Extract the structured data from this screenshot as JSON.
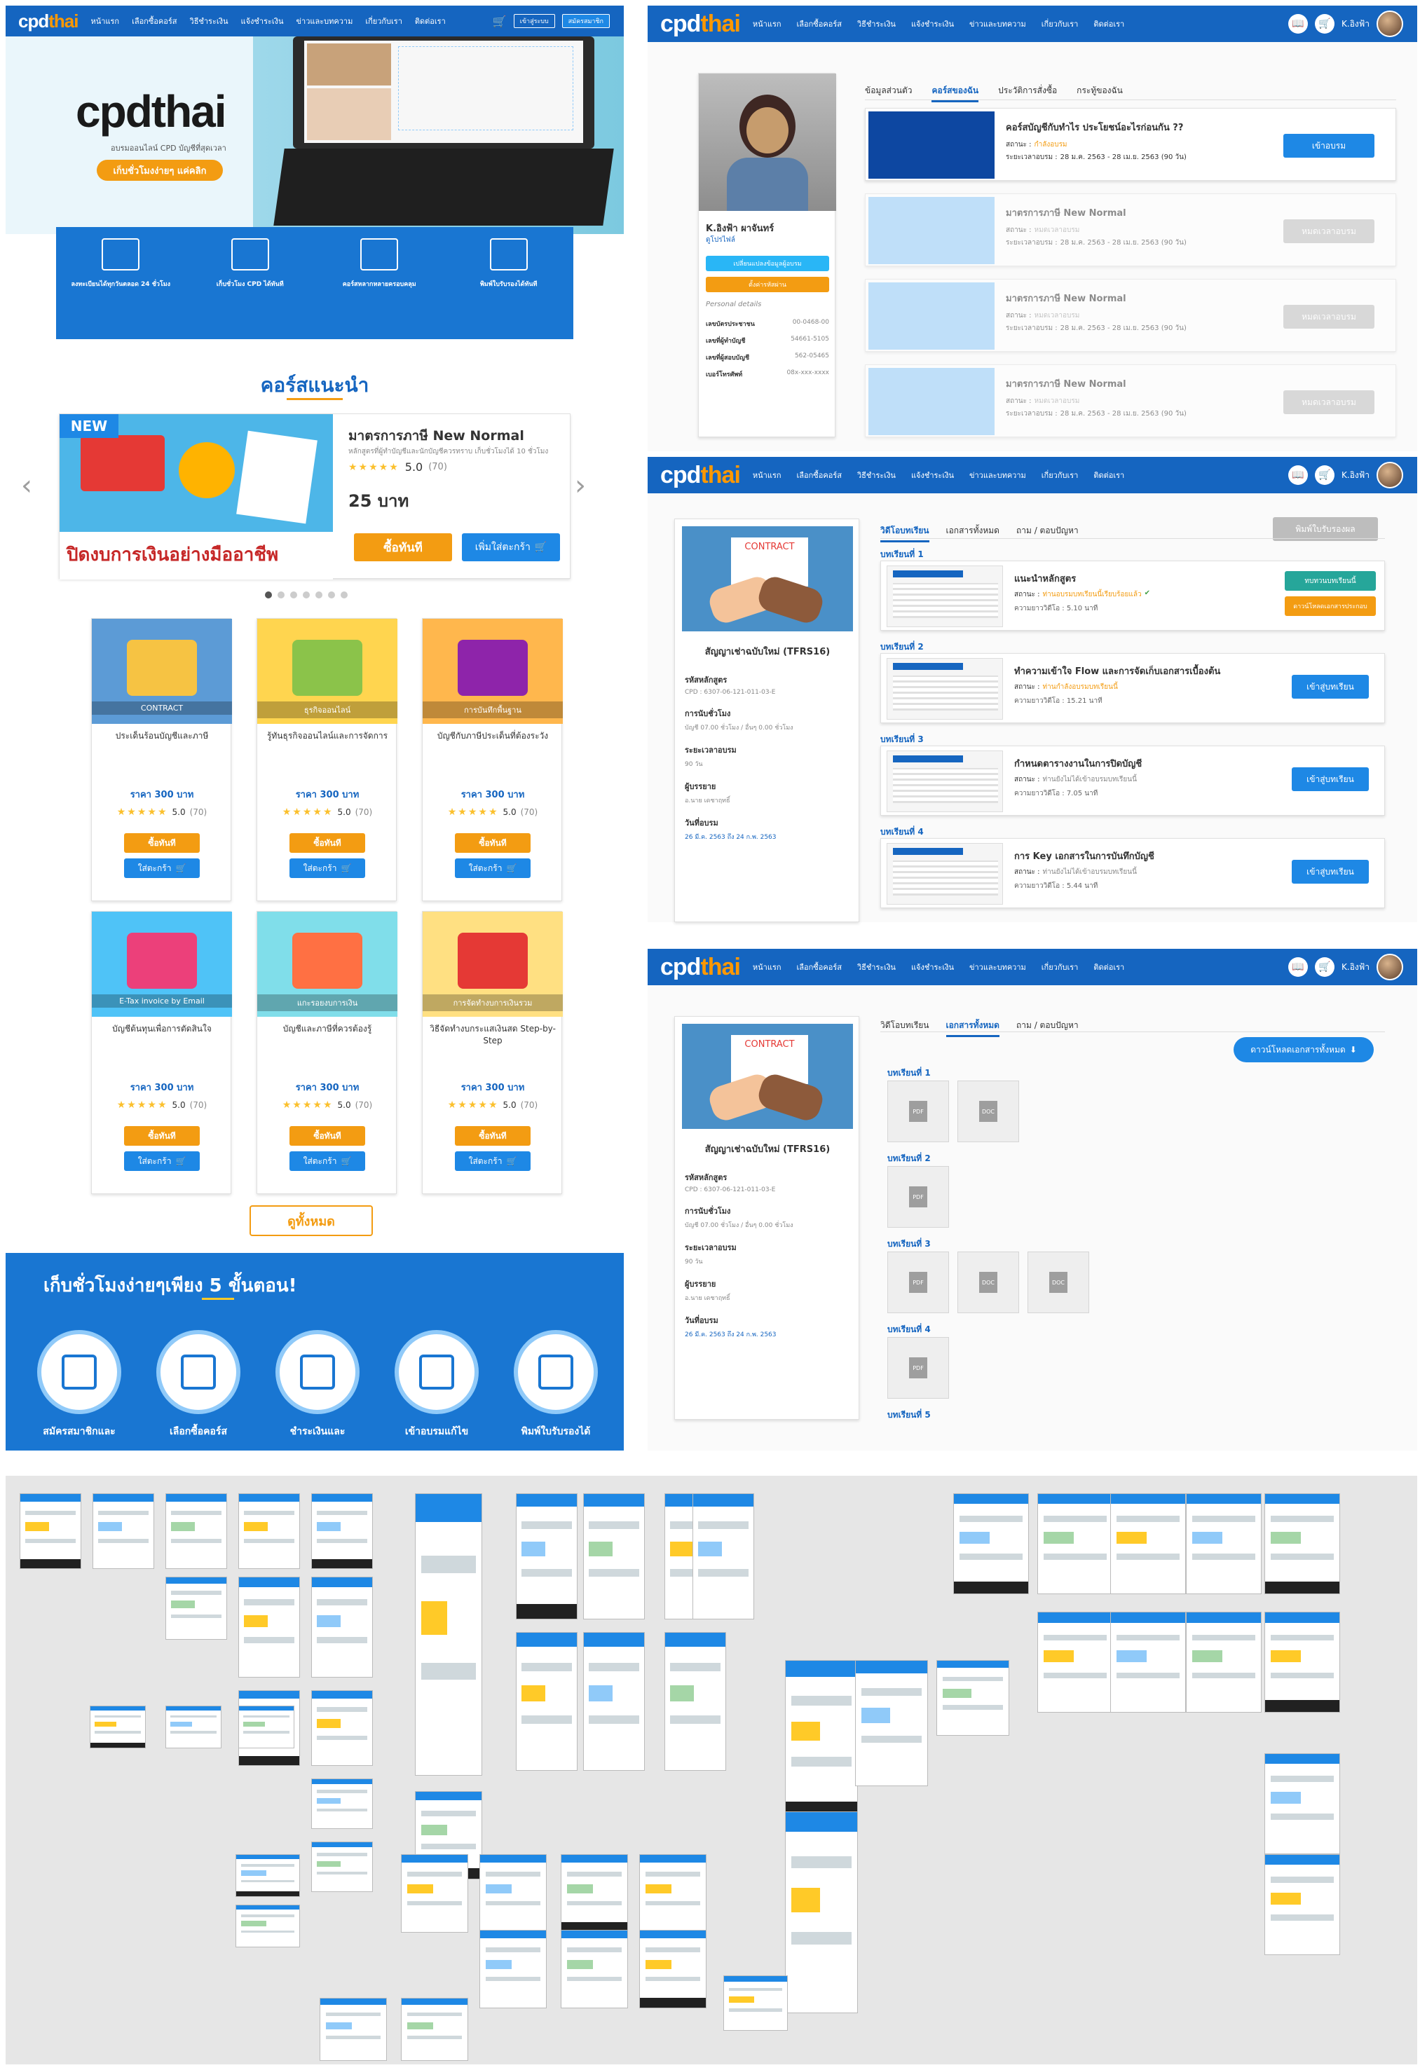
{
  "nav": {
    "logo_main": "cpd",
    "logo_accent": "thai",
    "menu": [
      "หน้าแรก",
      "เลือกซื้อคอร์ส",
      "วิธีชำระเงิน",
      "แจ้งชำระเงิน",
      "ข่าวและบทความ",
      "เกี่ยวกับเรา",
      "ติดต่อเรา"
    ],
    "user_name": "K.อิงฟ้า",
    "cart_count": "0",
    "login_label": "เข้าสู่ระบบ",
    "register_label": "สมัครสมาชิก"
  },
  "home": {
    "hero_logo": "cpdthai",
    "hero_tagline": "อบรมออนไลน์ CPD บัญชีที่สุดเวลา",
    "hero_button": "เก็บชั่วโมงง่ายๆ แค่คลิก",
    "features": [
      "ลงทะเบียนได้ทุกวันตลอด 24 ชั่วโมง",
      "เก็บชั่วโมง CPD ได้ทันที",
      "คอร์สหลากหลายครอบคลุม",
      "พิมพ์ใบรับรองได้ทันที"
    ],
    "recommend_title": "คอร์สแนะนำ",
    "featured": {
      "badge": "NEW",
      "title": "มาตรการภาษี New Normal",
      "desc": "หลักสูตรที่ผู้ทำบัญชีและนักบัญชีควรทราบ เก็บชั่วโมงได้ 10 ชั่วโมง",
      "rating": "5.0",
      "reviews": "(70)",
      "price": "25 บาท",
      "banner_text": "ปิดงบการเงินอย่างมืออาชีพ",
      "buy_label": "ซื้อทันที",
      "cart_label": "เพิ่มใส่ตะกร้า"
    },
    "courses": [
      {
        "title": "ประเด็นร้อนบัญชีและภาษี",
        "price": "ราคา 300 บาท",
        "rating": "5.0",
        "reviews": "(70)",
        "art": "#5c9bd6",
        "accent": "#f6c343",
        "tag": "CONTRACT"
      },
      {
        "title": "รู้ทันธุรกิจออนไลน์และการจัดการ",
        "price": "ราคา 300 บาท",
        "rating": "5.0",
        "reviews": "(70)",
        "art": "#ffd54f",
        "accent": "#8bc34a",
        "tag": "ธุรกิจออนไลน์"
      },
      {
        "title": "บัญชีกับภาษีประเด็นที่ต้องระวัง",
        "price": "ราคา 300 บาท",
        "rating": "5.0",
        "reviews": "(70)",
        "art": "#ffb74d",
        "accent": "#8e24aa",
        "tag": "การบันทึกพื้นฐาน"
      },
      {
        "title": "บัญชีต้นทุนเพื่อการตัดสินใจ",
        "price": "ราคา 300 บาท",
        "rating": "5.0",
        "reviews": "(70)",
        "art": "#4fc3f7",
        "accent": "#ec407a",
        "tag": "E-Tax invoice by Email"
      },
      {
        "title": "บัญชีและภาษีที่ควรต้องรู้",
        "price": "ราคา 300 บาท",
        "rating": "5.0",
        "reviews": "(70)",
        "art": "#80deea",
        "accent": "#ff7043",
        "tag": "แกะรอยงบการเงิน"
      },
      {
        "title": "วิธีจัดทำงบกระแสเงินสด Step-by-Step",
        "price": "ราคา 300 บาท",
        "rating": "5.0",
        "reviews": "(70)",
        "art": "#ffe082",
        "accent": "#e53935",
        "tag": "การจัดทำงบการเงินรวม"
      }
    ],
    "buy_label": "ซื้อทันที",
    "cart_label": "ใส่ตะกร้า",
    "view_all": "ดูทั้งหมด",
    "steps_title": "เก็บชั่วโมงง่ายๆเพียง 5 ขั้นตอน!",
    "steps": [
      "สมัครสมาชิกและ",
      "เลือกซื้อคอร์ส",
      "ชำระเงินและ",
      "เข้าอบรมแก้ไข",
      "พิมพ์ใบรับรองได้"
    ]
  },
  "profile": {
    "tabs": [
      "ข้อมูลส่วนตัว",
      "คอร์สของฉัน",
      "ประวัติการสั่งซื้อ",
      "กระทู้ของฉัน"
    ],
    "name": "K.อิงฟ้า ผาจันทร์",
    "edit_link": "ดูโปรไฟล์",
    "btn_profile": "เปลี่ยนแปลงข้อมูลผู้อบรม",
    "btn_password": "ตั้งค่ารหัสผ่าน",
    "info_title": "Personal details",
    "info": [
      [
        "เลขบัตรประชาชน",
        "00-0468-00"
      ],
      [
        "เลขที่ผู้ทำบัญชี",
        "54661-5105"
      ],
      [
        "เลขที่ผู้สอบบัญชี",
        "562-05465"
      ],
      [
        "เบอร์โทรศัพท์",
        "08x-xxx-xxxx"
      ]
    ],
    "courses": [
      {
        "title": "คอร์สบัญชีกับทำไร ประโยชน์อะไรก่อนกัน ??",
        "status": "กำลังอบรม",
        "period": "28 ม.ค. 2563 - 28 เม.ย. 2563 (90 วัน)",
        "button": "เข้าอบรม",
        "active": true
      },
      {
        "title": "มาตรการภาษี New Normal",
        "status": "หมดเวลาอบรม",
        "period": "28 ม.ค. 2563 - 28 เม.ย. 2563 (90 วัน)",
        "button": "หมดเวลาอบรม",
        "active": false
      },
      {
        "title": "มาตรการภาษี New Normal",
        "status": "หมดเวลาอบรม",
        "period": "28 ม.ค. 2563 - 28 เม.ย. 2563 (90 วัน)",
        "button": "หมดเวลาอบรม",
        "active": false
      },
      {
        "title": "มาตรการภาษี New Normal",
        "status": "หมดเวลาอบรม",
        "period": "28 ม.ค. 2563 - 28 เม.ย. 2563 (90 วัน)",
        "button": "หมดเวลาอบรม",
        "active": false
      }
    ],
    "status_label": "สถานะ :",
    "period_label": "ระยะเวลาอบรม :"
  },
  "lesson": {
    "course_title": "สัญญาเช่าฉบับใหม่ (TFRS16)",
    "tabs": [
      "วิดีโอบทเรียน",
      "เอกสารทั้งหมด",
      "ถาม / ตอบปัญหา"
    ],
    "print_label": "พิมพ์ใบรับรองผล",
    "side": [
      [
        "รหัสหลักสูตร",
        "CPD : 6307-06-121-011-03-E"
      ],
      [
        "การนับชั่วโมง",
        "บัญชี 07.00 ชั่วโมง / อื่นๆ 0.00 ชั่วโมง"
      ],
      [
        "ระยะเวลาอบรม",
        "90 วัน"
      ],
      [
        "ผู้บรรยาย",
        "อ.นาย เดชาฤทธิ์"
      ],
      [
        "วันที่อบรม",
        "26 มี.ค. 2563 ถึง 24 ก.พ. 2563"
      ]
    ],
    "chapters": [
      {
        "label": "บทเรียนที่ 1",
        "title": "แนะนำหลักสูตร",
        "status": "ท่านอบรมบทเรียนนี้เรียบร้อยแล้ว",
        "duration": "ความยาววิดีโอ : 5.10 นาที",
        "button": "ทบทวนบทเรียนนี้",
        "button2": "ดาวน์โหลดเอกสารประกอบ",
        "done": true
      },
      {
        "label": "บทเรียนที่ 2",
        "title": "ทำความเข้าใจ Flow และการจัดเก็บเอกสารเบื้องต้น",
        "status": "ท่านกำลังอบรมบทเรียนนี้",
        "duration": "ความยาววิดีโอ : 15.21 นาที",
        "button": "เข้าสู่บทเรียน",
        "done": false
      },
      {
        "label": "บทเรียนที่ 3",
        "title": "กำหนดตารางงานในการปิดบัญชี",
        "status": "ท่านยังไม่ได้เข้าอบรมบทเรียนนี้",
        "duration": "ความยาววิดีโอ : 7.05 นาที",
        "button": "เข้าสู่บทเรียน",
        "done": false
      },
      {
        "label": "บทเรียนที่ 4",
        "title": "การ Key เอกสารในการบันทึกบัญชี",
        "status": "ท่านยังไม่ได้เข้าอบรมบทเรียนนี้",
        "duration": "ความยาววิดีโอ : 5.44 นาที",
        "button": "เข้าสู่บทเรียน",
        "done": false
      }
    ],
    "status_label": "สถานะ :",
    "contract_tag": "CONTRACT"
  },
  "docs": {
    "download_all": "ดาวน์โหลดเอกสารทั้งหมด",
    "chapters": [
      {
        "label": "บทเรียนที่ 1",
        "files": [
          "PDF",
          "DOC"
        ]
      },
      {
        "label": "บทเรียนที่ 2",
        "files": [
          "PDF"
        ]
      },
      {
        "label": "บทเรียนที่ 3",
        "files": [
          "PDF",
          "DOC",
          "DOC"
        ]
      },
      {
        "label": "บทเรียนที่ 4",
        "files": [
          "PDF"
        ]
      },
      {
        "label": "บทเรียนที่ 5",
        "files": []
      }
    ]
  },
  "colors": {
    "primary": "#1565c0",
    "accent": "#f39c12",
    "canvas": "#e6e6e6"
  }
}
